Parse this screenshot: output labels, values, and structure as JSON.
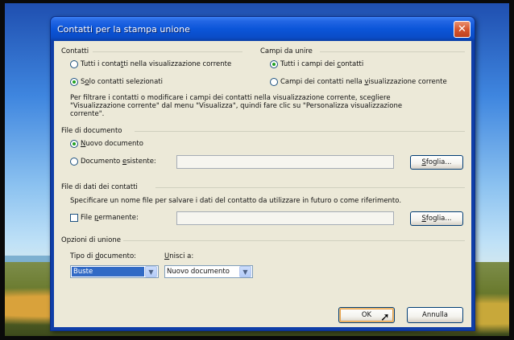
{
  "window": {
    "title": "Contatti per la stampa unione",
    "close_glyph": "✕"
  },
  "contatti": {
    "title": "Contatti",
    "options": [
      {
        "pre": "Tutti i conta",
        "u": "t",
        "post": "ti nella visualizzazione corrente",
        "selected": false
      },
      {
        "pre": "S",
        "u": "o",
        "post": "lo contatti selezionati",
        "selected": true
      }
    ]
  },
  "campi": {
    "title": "Campi da unire",
    "options": [
      {
        "pre": "Tutti i campi dei ",
        "u": "c",
        "post": "ontatti",
        "selected": true
      },
      {
        "pre": "Campi dei contatti nella ",
        "u": "v",
        "post": "isualizzazione corrente",
        "selected": false
      }
    ]
  },
  "info_text": [
    "Per filtrare i contatti o modificare i campi dei contatti nella visualizzazione corrente, scegliere",
    "\"Visualizzazione corrente\" dal menu \"Visualizza\", quindi fare clic su \"Personalizza visualizzazione",
    "corrente\"."
  ],
  "file_documento": {
    "title": "File di documento",
    "nuovo": {
      "pre": "",
      "u": "N",
      "post": "uovo documento",
      "selected": true
    },
    "esistente": {
      "pre": "Documento ",
      "u": "e",
      "post": "sistente:",
      "selected": false
    },
    "path_value": "",
    "browse": {
      "pre": "",
      "u": "S",
      "post": "foglia..."
    }
  },
  "file_dati": {
    "title": "File di dati dei contatti",
    "description": "Specificare un nome file per salvare i dati del contatto da utilizzare in futuro o come riferimento.",
    "permanente": {
      "pre": "File ",
      "u": "p",
      "post": "ermanente:",
      "checked": false
    },
    "path_value": "",
    "browse": {
      "pre": "",
      "u": "S",
      "post": "foglia..."
    }
  },
  "opzioni": {
    "title": "Opzioni di unione",
    "tipo_label": {
      "pre": "Tipo di ",
      "u": "d",
      "post": "ocumento:"
    },
    "tipo_value": "Buste",
    "unisci_label": {
      "pre": "",
      "u": "U",
      "post": "nisci a:"
    },
    "unisci_value": "Nuovo documento"
  },
  "buttons": {
    "ok": "OK",
    "annulla": "Annulla"
  },
  "icons": {
    "dropdown": "▼",
    "cursor": "➚"
  }
}
